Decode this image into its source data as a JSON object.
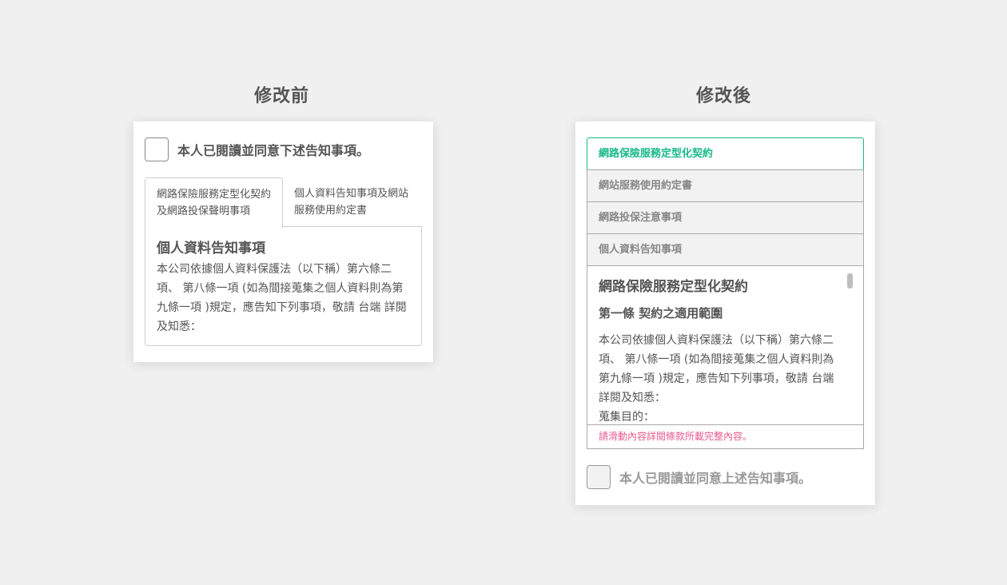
{
  "before": {
    "title": "修改前",
    "agree_label": "本人已閱讀並同意下述告知事項。",
    "tabs": [
      {
        "label": "網路保險服務定型化契約及網路投保聲明事項"
      },
      {
        "label": "個人資料告知事項及網站服務使用約定書"
      }
    ],
    "panel": {
      "heading": "個人資料告知事項",
      "body": "本公司依據個人資料保護法（以下稱）第六條二項、 第八條一項 (如為間接蒐集之個人資料則為第九條一項 )規定，應告知下列事項，敬請 台端 詳閱及知悉："
    }
  },
  "after": {
    "title": "修改後",
    "accordion": [
      {
        "label": "網路保險服務定型化契約"
      },
      {
        "label": "網站服務使用約定書"
      },
      {
        "label": "網路投保注意事項"
      },
      {
        "label": "個人資料告知事項"
      }
    ],
    "content": {
      "heading": "網路保險服務定型化契約",
      "subheading": "第一條 契約之適用範圍",
      "body": "本公司依據個人資料保護法（以下稱）第六條二項、 第八條一項 (如為間接蒐集之個人資料則為第九條一項 )規定，應告知下列事項，敬請 台端 詳閱及知悉：",
      "partial_line": "蒐集目的："
    },
    "scroll_hint": "請滑動內容詳閱條款所載完整內容。",
    "agree_label": "本人已閱讀並同意上述告知事項。"
  },
  "colors": {
    "accent": "#19b987",
    "hint": "#e85a8c",
    "background": "#f0f0f0"
  }
}
